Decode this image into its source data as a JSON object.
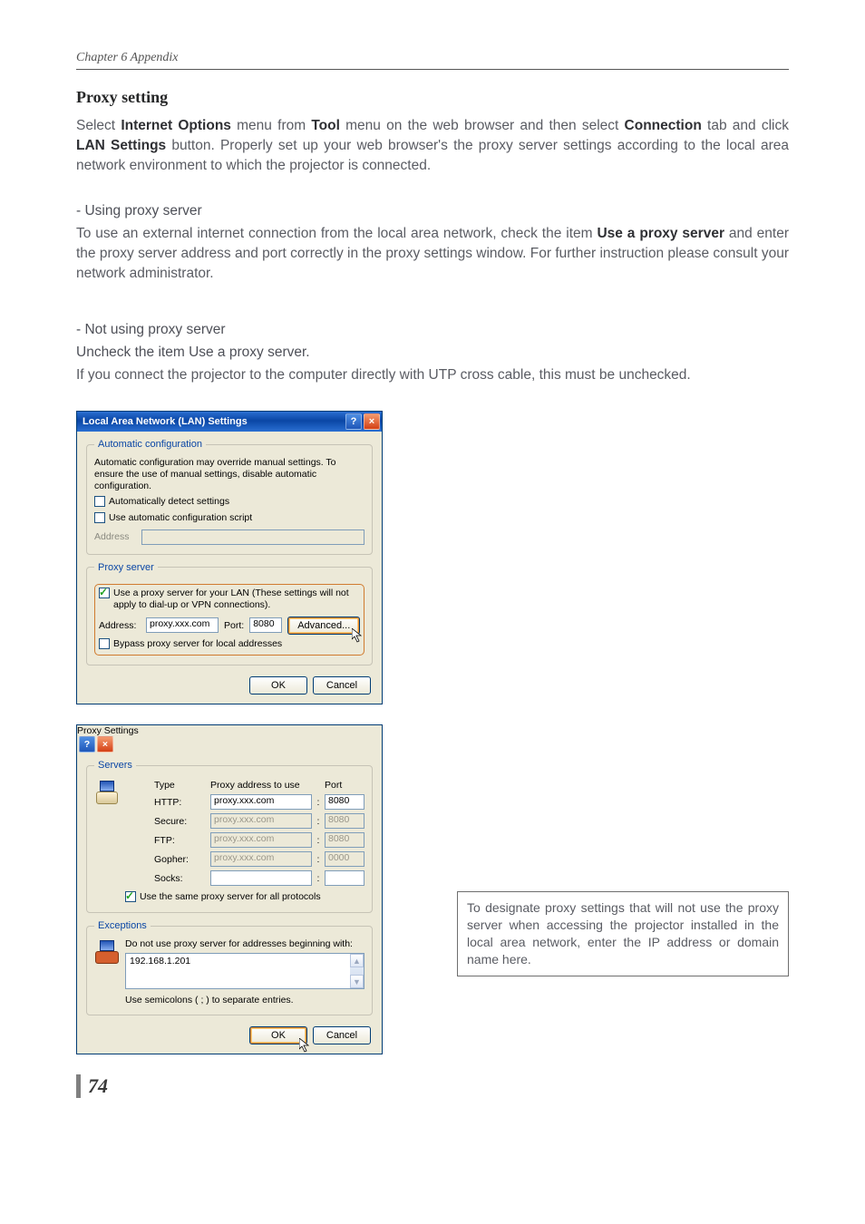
{
  "chapter": "Chapter 6 Appendix",
  "section_title": "Proxy setting",
  "intro_parts": [
    "Select ",
    {
      "bold": "Internet Options"
    },
    " menu from ",
    {
      "bold": "Tool"
    },
    " menu on the web browser and then select ",
    {
      "bold": "Connection"
    },
    " tab and click ",
    {
      "bold": "LAN Settings"
    },
    " button. Properly set up your web browser's the proxy server settings according to the local area network environment to which the projector is connected."
  ],
  "using_proxy": {
    "heading": "- Using proxy server",
    "parts": [
      "To use an external internet connection from the local area network, check the item ",
      {
        "bold": "Use a proxy server"
      },
      " and enter the proxy server address and port correctly in the proxy settings window. For further instruction please consult your network administrator."
    ]
  },
  "not_using_proxy": {
    "heading": "- Not using proxy server",
    "line1_parts": [
      "Uncheck the item ",
      {
        "bold": "Use a proxy server"
      },
      "."
    ],
    "line2": "If you connect the projector to the computer directly with UTP cross cable, this must be unchecked."
  },
  "dialog_lan": {
    "title": "Local Area Network (LAN) Settings",
    "help_icon": "?",
    "close_icon": "×",
    "autoconf": {
      "legend": "Automatic configuration",
      "desc": "Automatic configuration may override manual settings.  To ensure the use of manual settings, disable automatic configuration.",
      "detect": "Automatically detect settings",
      "script": "Use automatic configuration script",
      "address_label": "Address"
    },
    "proxy": {
      "legend": "Proxy server",
      "use_label": "Use a proxy server for your LAN (These settings will not apply to dial-up or VPN connections).",
      "address_label": "Address:",
      "address_value": "proxy.xxx.com",
      "port_label": "Port:",
      "port_value": "8080",
      "advanced": "Advanced...",
      "bypass": "Bypass proxy server for local addresses"
    },
    "ok": "OK",
    "cancel": "Cancel"
  },
  "dialog_proxy": {
    "title": "Proxy Settings",
    "servers_legend": "Servers",
    "col_type": "Type",
    "col_addr": "Proxy address to use",
    "col_port": "Port",
    "rows": [
      {
        "label": "HTTP:",
        "addr": "proxy.xxx.com",
        "port": "8080",
        "enabled": true
      },
      {
        "label": "Secure:",
        "addr": "proxy.xxx.com",
        "port": "8080",
        "enabled": false
      },
      {
        "label": "FTP:",
        "addr": "proxy.xxx.com",
        "port": "8080",
        "enabled": false
      },
      {
        "label": "Gopher:",
        "addr": "proxy.xxx.com",
        "port": "0000",
        "enabled": false
      },
      {
        "label": "Socks:",
        "addr": "",
        "port": "",
        "enabled": true
      }
    ],
    "same_proxy": "Use the same proxy server for all protocols",
    "exceptions_legend": "Exceptions",
    "exc_label": "Do not use proxy server for addresses beginning with:",
    "exc_value": "192.168.1.201",
    "exc_hint": "Use semicolons ( ; ) to separate entries.",
    "ok": "OK",
    "cancel": "Cancel"
  },
  "sidenote": "To designate proxy settings that will not use the proxy server when accessing the projector installed in the local area network, enter the IP address or domain name here.",
  "page_number": "74"
}
